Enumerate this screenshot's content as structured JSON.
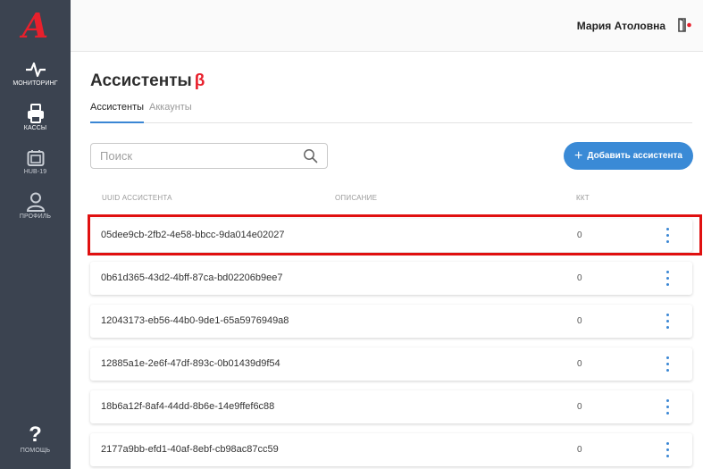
{
  "sidebar": {
    "logo_text": "A",
    "items": [
      {
        "label": "Мониторинг",
        "icon": "pulse-icon"
      },
      {
        "label": "Кассы",
        "icon": "printer-icon"
      },
      {
        "label": "HUB-19",
        "icon": "hub-icon"
      },
      {
        "label": "Профиль",
        "icon": "user-icon"
      }
    ],
    "help": {
      "label": "Помощь",
      "glyph": "?",
      "icon": "question-icon"
    }
  },
  "header": {
    "user_name": "Мария Атоловна",
    "logout_icon": "logout-icon"
  },
  "page": {
    "title": "Ассистенты",
    "beta": "β"
  },
  "tabs": [
    {
      "label": "Ассистенты",
      "active": true
    },
    {
      "label": "Аккаунты",
      "active": false
    }
  ],
  "search": {
    "placeholder": "Поиск",
    "value": ""
  },
  "add_button": {
    "plus": "+",
    "label": "Добавить ассистента"
  },
  "table": {
    "columns": [
      "UUID ассистента",
      "Описание",
      "ККТ"
    ],
    "rows": [
      {
        "uuid": "05dee9cb-2fb2-4e58-bbcc-9da014e02027",
        "description": "",
        "kkt": "0"
      },
      {
        "uuid": "0b61d365-43d2-4bff-87ca-bd02206b9ee7",
        "description": "",
        "kkt": "0"
      },
      {
        "uuid": "12043173-eb56-44b0-9de1-65a5976949a8",
        "description": "",
        "kkt": "0"
      },
      {
        "uuid": "12885a1e-2e6f-47df-893c-0b01439d9f54",
        "description": "",
        "kkt": "0"
      },
      {
        "uuid": "18b6a12f-8af4-44dd-8b6e-14e9ffef6c88",
        "description": "",
        "kkt": "0"
      },
      {
        "uuid": "2177a9bb-efd1-40af-8ebf-cb98ac87cc59",
        "description": "",
        "kkt": "0"
      }
    ]
  },
  "colors": {
    "sidebar": "#3b4350",
    "accent": "#3a86d4",
    "brand_red": "#e8202c",
    "highlight": "#e01010"
  }
}
